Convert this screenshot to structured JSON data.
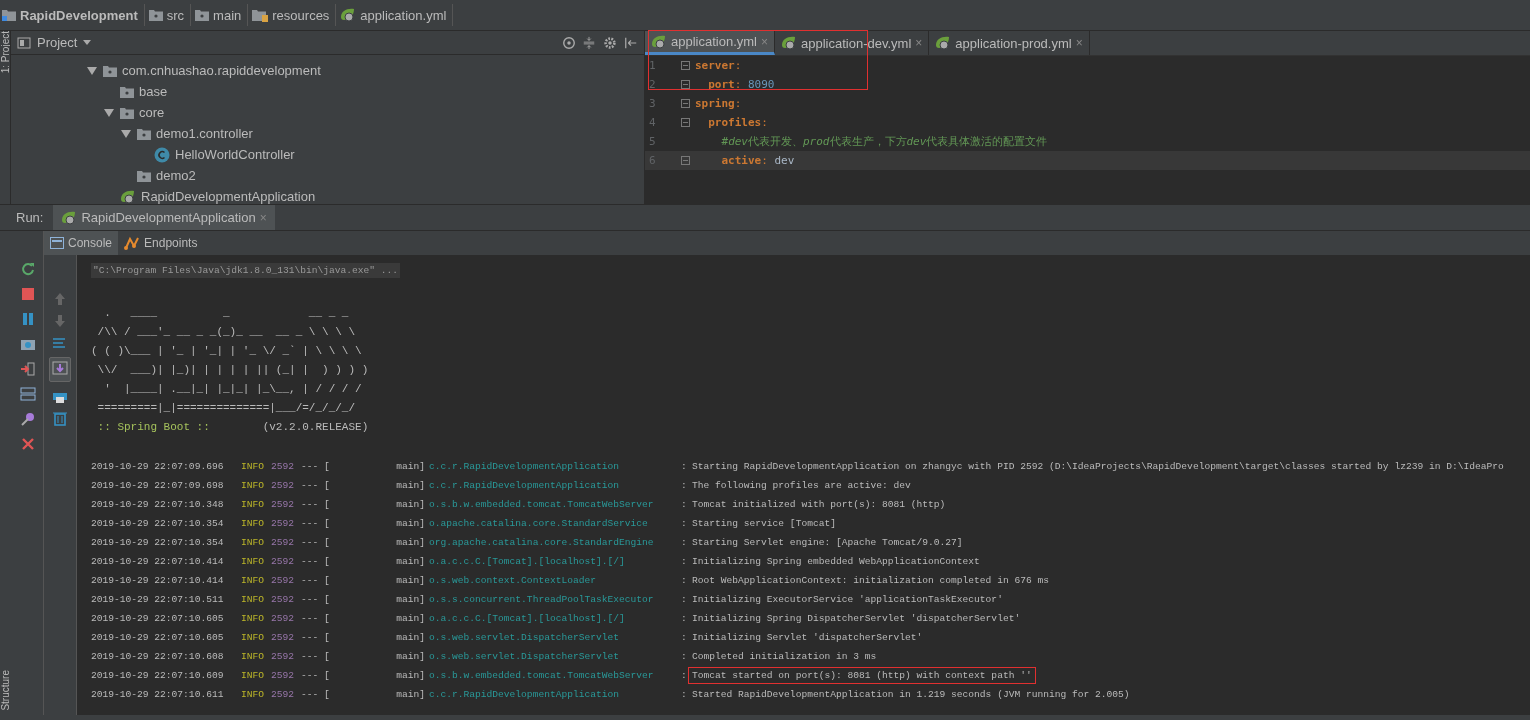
{
  "breadcrumbs": [
    {
      "kind": "project",
      "label": "RapidDevelopment"
    },
    {
      "kind": "folder",
      "label": "src"
    },
    {
      "kind": "folder",
      "label": "main"
    },
    {
      "kind": "resources",
      "label": "resources"
    },
    {
      "kind": "yml",
      "label": "application.yml"
    }
  ],
  "side_tabs": {
    "top": "1: Project",
    "bottom": "Structure"
  },
  "project": {
    "title": "Project",
    "tree": [
      {
        "kind": "package",
        "label": "com.cnhuashao.rapiddevelopment",
        "expanded": true,
        "children": [
          {
            "kind": "package",
            "label": "base",
            "expanded": false
          },
          {
            "kind": "package",
            "label": "core",
            "expanded": true,
            "children": [
              {
                "kind": "package",
                "label": "demo1.controller",
                "expanded": true,
                "children": [
                  {
                    "kind": "class",
                    "label": "HelloWorldController"
                  }
                ]
              },
              {
                "kind": "package",
                "label": "demo2",
                "expanded": false
              }
            ]
          },
          {
            "kind": "spring-app",
            "label": "RapidDevelopmentApplication"
          }
        ]
      }
    ]
  },
  "editor": {
    "outline_box": true,
    "tabs": [
      {
        "label": "application.yml",
        "close": "×",
        "selected": true
      },
      {
        "label": "application-dev.yml",
        "close": "×",
        "selected": false
      },
      {
        "label": "application-prod.yml",
        "close": "×",
        "selected": false
      }
    ],
    "lines": [
      {
        "number": "1",
        "fold": true,
        "current": false,
        "tokens": [
          {
            "kind": "key",
            "text": "server"
          },
          {
            "kind": "punct",
            "text": ":"
          }
        ]
      },
      {
        "number": "2",
        "fold": true,
        "current": false,
        "tokens": [
          {
            "kind": "key",
            "text": "  port"
          },
          {
            "kind": "punct",
            "text": ": "
          },
          {
            "kind": "number",
            "text": "8090"
          }
        ]
      },
      {
        "number": "3",
        "fold": true,
        "current": false,
        "tokens": [
          {
            "kind": "key",
            "text": "spring"
          },
          {
            "kind": "punct",
            "text": ":"
          }
        ]
      },
      {
        "number": "4",
        "fold": true,
        "current": false,
        "tokens": [
          {
            "kind": "key",
            "text": "  profiles"
          },
          {
            "kind": "punct",
            "text": ":"
          }
        ]
      },
      {
        "number": "5",
        "fold": false,
        "current": false,
        "tokens": [
          {
            "kind": "comment",
            "text": "    #"
          },
          {
            "kind": "comment-em",
            "text": "dev"
          },
          {
            "kind": "comment",
            "text": "代表开发、"
          },
          {
            "kind": "comment-em",
            "text": "prod"
          },
          {
            "kind": "comment",
            "text": "代表生产，下方"
          },
          {
            "kind": "comment-em",
            "text": "dev"
          },
          {
            "kind": "comment",
            "text": "代表具体激活的配置文件"
          }
        ]
      },
      {
        "number": "6",
        "fold": true,
        "current": true,
        "tokens": [
          {
            "kind": "key",
            "text": "    active"
          },
          {
            "kind": "punct",
            "text": ": "
          },
          {
            "kind": "value",
            "text": "dev"
          }
        ]
      }
    ]
  },
  "run": {
    "label": "Run:",
    "tab": "RapidDevelopmentApplication",
    "close": "×"
  },
  "console": {
    "tabs": [
      {
        "kind": "console",
        "label": "Console",
        "selected": true
      },
      {
        "kind": "endpoints",
        "label": "Endpoints",
        "selected": false
      }
    ],
    "command": "\"C:\\Program Files\\Java\\jdk1.8.0_131\\bin\\java.exe\" ...",
    "banner": [
      "  .   ____          _            __ _ _",
      " /\\\\ / ___'_ __ _ _(_)_ __  __ _ \\ \\ \\ \\",
      "( ( )\\___ | '_ | '_| | '_ \\/ _` | \\ \\ \\ \\",
      " \\\\/  ___)| |_)| | | | | || (_| |  ) ) ) )",
      "  '  |____| .__|_| |_|_| |_\\__, | / / / /",
      " =========|_|==============|___/=/_/_/_/"
    ],
    "banner_footer": {
      "label": " :: Spring Boot :: ",
      "version": "       (v2.2.0.RELEASE)"
    },
    "log": [
      {
        "time": "2019-10-29 22:07:09.696",
        "level": "INFO",
        "pid": "2592",
        "sep": "--- [",
        "thread": "main]",
        "logger": "c.c.r.RapidDevelopmentApplication",
        "colon": ":",
        "message": "Starting RapidDevelopmentApplication on zhangyc with PID 2592 (D:\\IdeaProjects\\RapidDevelopment\\target\\classes started by lz239 in D:\\IdeaPro",
        "outlined": false
      },
      {
        "time": "2019-10-29 22:07:09.698",
        "level": "INFO",
        "pid": "2592",
        "sep": "--- [",
        "thread": "main]",
        "logger": "c.c.r.RapidDevelopmentApplication",
        "colon": ":",
        "message": "The following profiles are active: dev",
        "outlined": false
      },
      {
        "time": "2019-10-29 22:07:10.348",
        "level": "INFO",
        "pid": "2592",
        "sep": "--- [",
        "thread": "main]",
        "logger": "o.s.b.w.embedded.tomcat.TomcatWebServer",
        "colon": ":",
        "message": "Tomcat initialized with port(s): 8081 (http)",
        "outlined": false
      },
      {
        "time": "2019-10-29 22:07:10.354",
        "level": "INFO",
        "pid": "2592",
        "sep": "--- [",
        "thread": "main]",
        "logger": "o.apache.catalina.core.StandardService",
        "colon": ":",
        "message": "Starting service [Tomcat]",
        "outlined": false
      },
      {
        "time": "2019-10-29 22:07:10.354",
        "level": "INFO",
        "pid": "2592",
        "sep": "--- [",
        "thread": "main]",
        "logger": "org.apache.catalina.core.StandardEngine",
        "colon": ":",
        "message": "Starting Servlet engine: [Apache Tomcat/9.0.27]",
        "outlined": false
      },
      {
        "time": "2019-10-29 22:07:10.414",
        "level": "INFO",
        "pid": "2592",
        "sep": "--- [",
        "thread": "main]",
        "logger": "o.a.c.c.C.[Tomcat].[localhost].[/]",
        "colon": ":",
        "message": "Initializing Spring embedded WebApplicationContext",
        "outlined": false
      },
      {
        "time": "2019-10-29 22:07:10.414",
        "level": "INFO",
        "pid": "2592",
        "sep": "--- [",
        "thread": "main]",
        "logger": "o.s.web.context.ContextLoader",
        "colon": ":",
        "message": "Root WebApplicationContext: initialization completed in 676 ms",
        "outlined": false
      },
      {
        "time": "2019-10-29 22:07:10.511",
        "level": "INFO",
        "pid": "2592",
        "sep": "--- [",
        "thread": "main]",
        "logger": "o.s.s.concurrent.ThreadPoolTaskExecutor",
        "colon": ":",
        "message": "Initializing ExecutorService 'applicationTaskExecutor'",
        "outlined": false
      },
      {
        "time": "2019-10-29 22:07:10.605",
        "level": "INFO",
        "pid": "2592",
        "sep": "--- [",
        "thread": "main]",
        "logger": "o.a.c.c.C.[Tomcat].[localhost].[/]",
        "colon": ":",
        "message": "Initializing Spring DispatcherServlet 'dispatcherServlet'",
        "outlined": false
      },
      {
        "time": "2019-10-29 22:07:10.605",
        "level": "INFO",
        "pid": "2592",
        "sep": "--- [",
        "thread": "main]",
        "logger": "o.s.web.servlet.DispatcherServlet",
        "colon": ":",
        "message": "Initializing Servlet 'dispatcherServlet'",
        "outlined": false
      },
      {
        "time": "2019-10-29 22:07:10.608",
        "level": "INFO",
        "pid": "2592",
        "sep": "--- [",
        "thread": "main]",
        "logger": "o.s.web.servlet.DispatcherServlet",
        "colon": ":",
        "message": "Completed initialization in 3 ms",
        "outlined": false
      },
      {
        "time": "2019-10-29 22:07:10.609",
        "level": "INFO",
        "pid": "2592",
        "sep": "--- [",
        "thread": "main]",
        "logger": "o.s.b.w.embedded.tomcat.TomcatWebServer",
        "colon": ":",
        "message": "Tomcat started on port(s): 8081 (http) with context path ''",
        "outlined": true
      },
      {
        "time": "2019-10-29 22:07:10.611",
        "level": "INFO",
        "pid": "2592",
        "sep": "--- [",
        "thread": "main]",
        "logger": "c.c.r.RapidDevelopmentApplication",
        "colon": ":",
        "message": "Started RapidDevelopmentApplication in 1.219 seconds (JVM running for 2.005)",
        "outlined": false
      }
    ]
  }
}
